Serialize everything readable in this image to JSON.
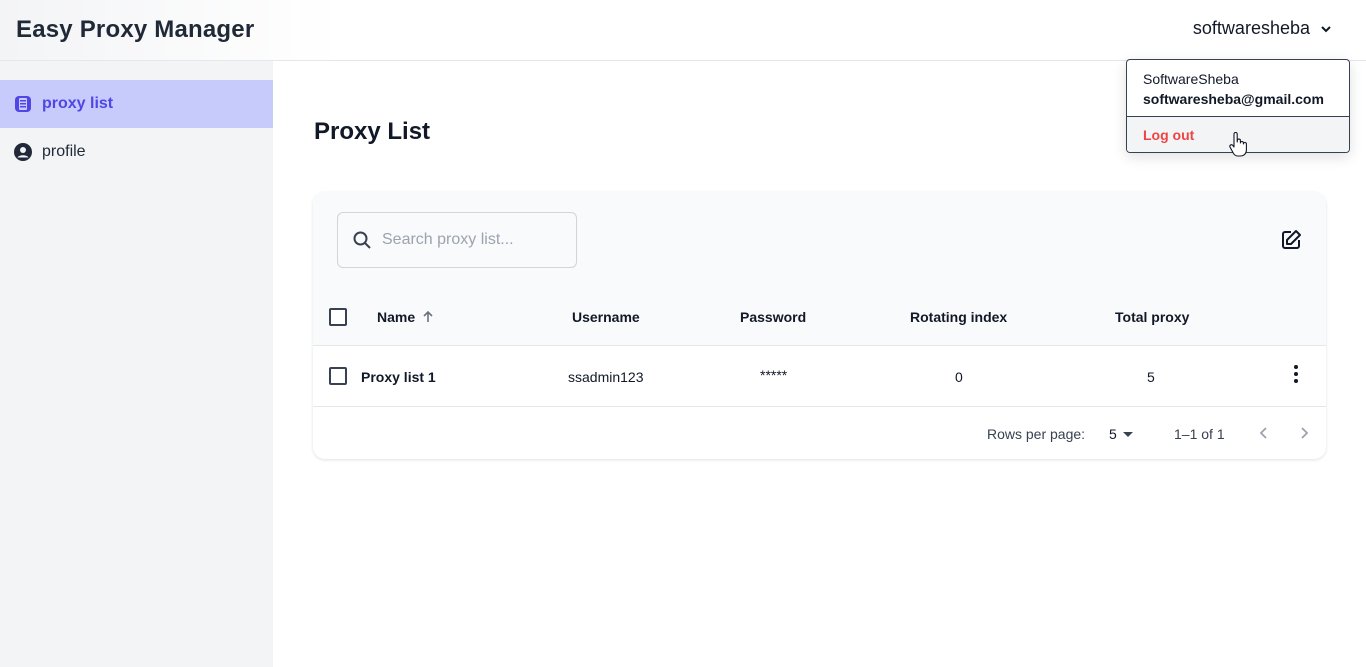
{
  "app": {
    "title": "Easy Proxy Manager"
  },
  "header": {
    "username": "softwaresheba"
  },
  "sidebar": {
    "items": [
      {
        "label": "proxy list",
        "icon": "proxy-list-icon",
        "active": true
      },
      {
        "label": "profile",
        "icon": "user-circle-icon",
        "active": false
      }
    ]
  },
  "main": {
    "page_title": "Proxy List",
    "search": {
      "placeholder": "Search proxy list...",
      "value": ""
    },
    "table": {
      "columns": [
        "Name",
        "Username",
        "Password",
        "Rotating index",
        "Total proxy"
      ],
      "sort": {
        "column": "Name",
        "direction": "ascending"
      },
      "rows": [
        {
          "name": "Proxy list 1",
          "username": "ssadmin123",
          "password": "*****",
          "rotating_index": "0",
          "total_proxy": "5"
        }
      ]
    },
    "pagination": {
      "rows_per_page_label": "Rows per page:",
      "rows_per_page": "5",
      "range": "1–1 of 1"
    }
  },
  "user_dropdown": {
    "display_name": "SoftwareSheba",
    "email": "softwaresheba@gmail.com",
    "logout_label": "Log out"
  },
  "colors": {
    "accent": "#4f46e5",
    "active_bg": "#c7cbfc",
    "danger": "#ef4444"
  }
}
